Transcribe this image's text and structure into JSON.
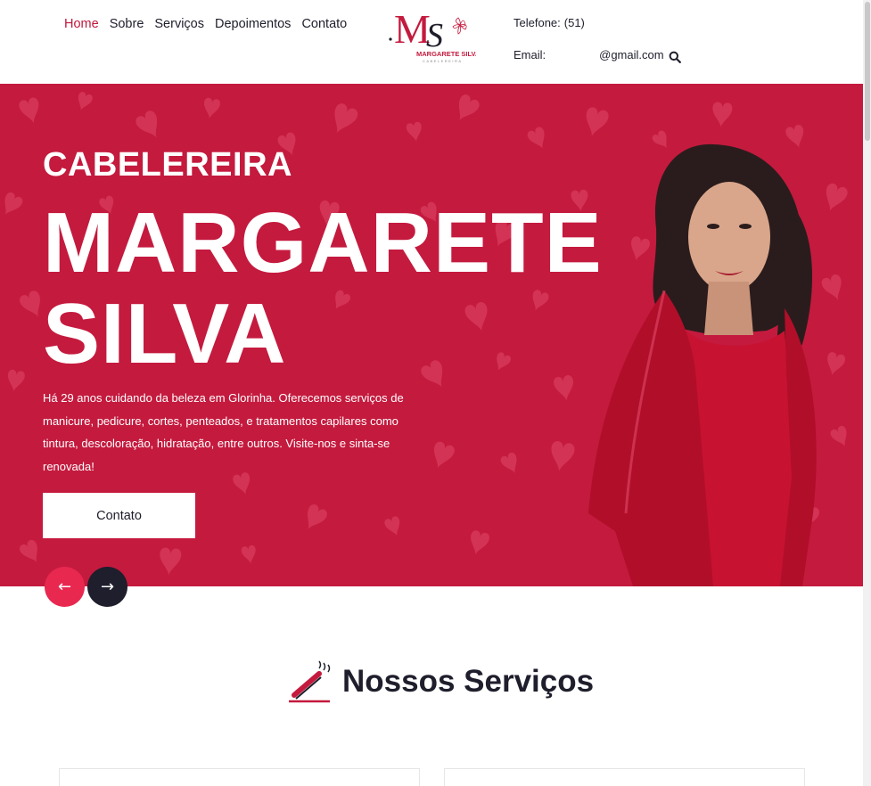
{
  "nav": {
    "items": [
      {
        "label": "Home",
        "active": true
      },
      {
        "label": "Sobre",
        "active": false
      },
      {
        "label": "Serviços",
        "active": false
      },
      {
        "label": "Depoimentos",
        "active": false
      },
      {
        "label": "Contato",
        "active": false
      }
    ]
  },
  "logo": {
    "monogram": "MS",
    "name": "MARGARETE SILVA",
    "tagline": "CABELEREIRA"
  },
  "contact": {
    "phone_label": "Telefone:",
    "phone_value": "(51)",
    "email_label": "Email:",
    "email_value": "@gmail.com"
  },
  "hero": {
    "subtitle": "CABELEREIRA",
    "title_line1": "MARGARETE",
    "title_line2": "SILVA",
    "description": "Há 29 anos cuidando da beleza em Glorinha. Oferecemos serviços de manicure, pedicure, cortes, penteados, e tratamentos capilares como tintura, descoloração, hidratação, entre outros. Visite-nos e sinta-se renovada!",
    "button_label": "Contato",
    "prev_arrow": "←",
    "next_arrow": "→"
  },
  "services": {
    "title": "Nossos Serviços"
  },
  "colors": {
    "brand": "#c41a3e",
    "accent": "#e8284f",
    "dark": "#1e1e2c"
  },
  "icons": [
    "search-icon",
    "prev-arrow-icon",
    "next-arrow-icon",
    "hair-straightener-icon"
  ]
}
